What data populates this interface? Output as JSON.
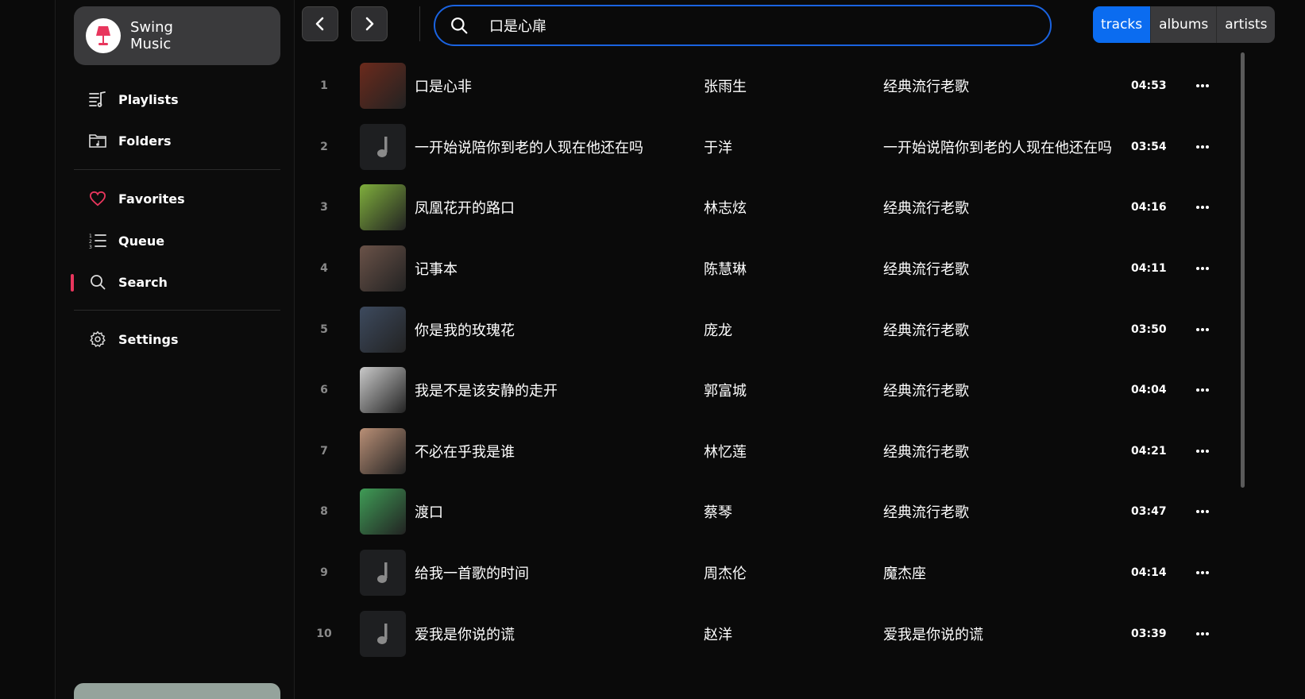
{
  "app": {
    "name": "Swing\nMusic"
  },
  "sidebar": {
    "items": [
      {
        "label": "Playlists",
        "icon": "playlist-icon"
      },
      {
        "label": "Folders",
        "icon": "folder-icon"
      },
      {
        "label": "Favorites",
        "icon": "heart-icon"
      },
      {
        "label": "Queue",
        "icon": "queue-icon"
      },
      {
        "label": "Search",
        "icon": "search-icon",
        "active": true
      },
      {
        "label": "Settings",
        "icon": "gear-icon"
      }
    ]
  },
  "search": {
    "value": "口是心扉",
    "placeholder": ""
  },
  "tabs": [
    {
      "label": "tracks",
      "active": true
    },
    {
      "label": "albums",
      "active": false
    },
    {
      "label": "artists",
      "active": false
    }
  ],
  "colors": {
    "accent": "#0b6cf0",
    "active_indicator": "#e8365d",
    "favorite": "#e8365d"
  },
  "tracks": [
    {
      "index": "1",
      "title": "口是心非",
      "artist": "张雨生",
      "album": "经典流行老歌",
      "duration": "04:53",
      "art": "cover",
      "art_color": "#6b2a1c"
    },
    {
      "index": "2",
      "title": "一开始说陪你到老的人现在他还在吗",
      "artist": "于洋",
      "album": "一开始说陪你到老的人现在他还在吗",
      "duration": "03:54",
      "art": "music-note-icon"
    },
    {
      "index": "3",
      "title": "凤凰花开的路口",
      "artist": "林志炫",
      "album": "经典流行老歌",
      "duration": "04:16",
      "art": "cover",
      "art_color": "#7fae3c"
    },
    {
      "index": "4",
      "title": "记事本",
      "artist": "陈慧琳",
      "album": "经典流行老歌",
      "duration": "04:11",
      "art": "cover",
      "art_color": "#6a5248"
    },
    {
      "index": "5",
      "title": "你是我的玫瑰花",
      "artist": "庞龙",
      "album": "经典流行老歌",
      "duration": "03:50",
      "art": "cover",
      "art_color": "#3d4a5e"
    },
    {
      "index": "6",
      "title": "我是不是该安静的走开",
      "artist": "郭富城",
      "album": "经典流行老歌",
      "duration": "04:04",
      "art": "cover",
      "art_color": "#c9c9c9"
    },
    {
      "index": "7",
      "title": "不必在乎我是谁",
      "artist": "林忆莲",
      "album": "经典流行老歌",
      "duration": "04:21",
      "art": "cover",
      "art_color": "#b98f76"
    },
    {
      "index": "8",
      "title": "渡口",
      "artist": "蔡琴",
      "album": "经典流行老歌",
      "duration": "03:47",
      "art": "cover",
      "art_color": "#3f9c56"
    },
    {
      "index": "9",
      "title": "给我一首歌的时间",
      "artist": "周杰伦",
      "album": "魔杰座",
      "duration": "04:14",
      "art": "music-note-icon"
    },
    {
      "index": "10",
      "title": "爱我是你说的谎",
      "artist": "赵洋",
      "album": "爱我是你说的谎",
      "duration": "03:39",
      "art": "music-note-icon"
    }
  ]
}
